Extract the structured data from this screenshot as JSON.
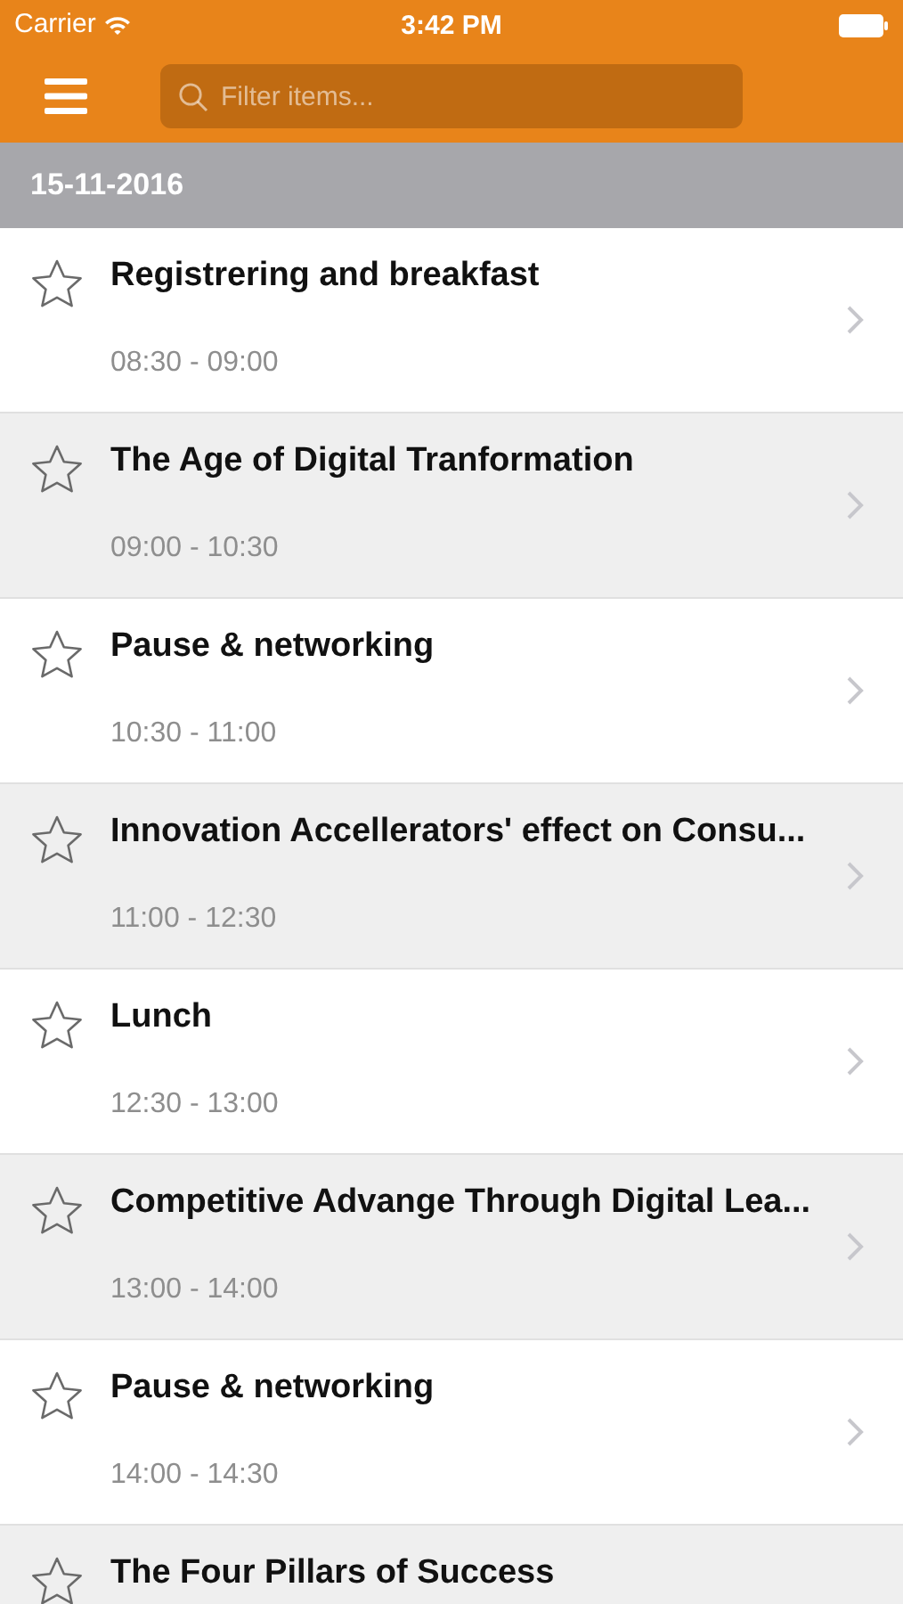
{
  "status_bar": {
    "carrier": "Carrier",
    "time": "3:42 PM"
  },
  "nav_bar": {
    "search": {
      "placeholder": "Filter items..."
    }
  },
  "section": {
    "date": "15-11-2016"
  },
  "sessions": [
    {
      "title": "Registrering and breakfast",
      "time": "08:30 - 09:00",
      "starred": false
    },
    {
      "title": "The Age of Digital Tranformation",
      "time": "09:00 - 10:30",
      "starred": false
    },
    {
      "title": "Pause & networking",
      "time": "10:30 - 11:00",
      "starred": false
    },
    {
      "title": "Innovation Accellerators' effect on Consu...",
      "time": "11:00 - 12:30",
      "starred": false
    },
    {
      "title": "Lunch",
      "time": "12:30 - 13:00",
      "starred": false
    },
    {
      "title": "Competitive Advange Through Digital Lea...",
      "time": "13:00 - 14:00",
      "starred": false
    },
    {
      "title": "Pause & networking",
      "time": "14:00 - 14:30",
      "starred": false
    },
    {
      "title": "The Four Pillars of Success",
      "starred": false
    }
  ]
}
